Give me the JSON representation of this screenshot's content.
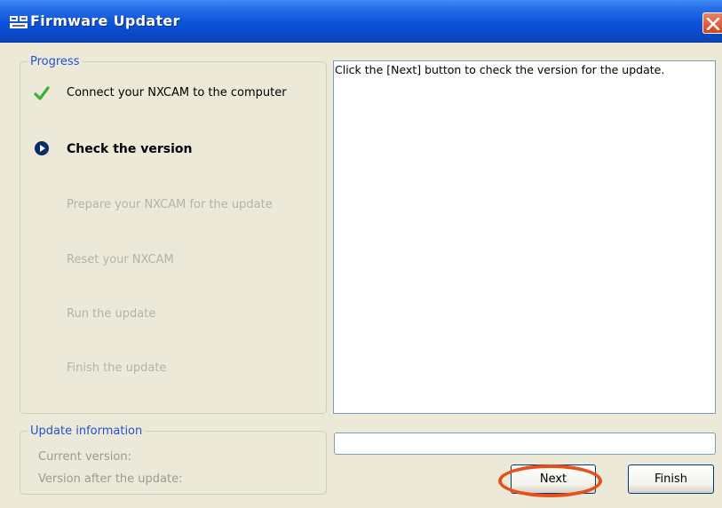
{
  "window": {
    "title": "Firmware Updater"
  },
  "progress": {
    "legend": "Progress",
    "steps": [
      {
        "label": "Connect your NXCAM to the computer",
        "state": "done",
        "icon": "check-icon"
      },
      {
        "label": "Check the version",
        "state": "current",
        "icon": "play-circle-icon"
      },
      {
        "label": "Prepare your NXCAM for the update",
        "state": "pending"
      },
      {
        "label": "Reset your NXCAM",
        "state": "pending"
      },
      {
        "label": "Run the update",
        "state": "pending"
      },
      {
        "label": "Finish the update",
        "state": "pending"
      }
    ]
  },
  "update_info": {
    "legend": "Update information",
    "current_version_label": "Current version:",
    "after_version_label": "Version after the update:"
  },
  "message": "Click the [Next] button to check the version for the update.",
  "buttons": {
    "next": "Next",
    "finish": "Finish"
  },
  "colors": {
    "titlebar": "#0A54DA",
    "legend": "#2450D8",
    "check": "#3BB030",
    "highlight": "#E8501A",
    "pending_text": "#B4B4A6"
  }
}
